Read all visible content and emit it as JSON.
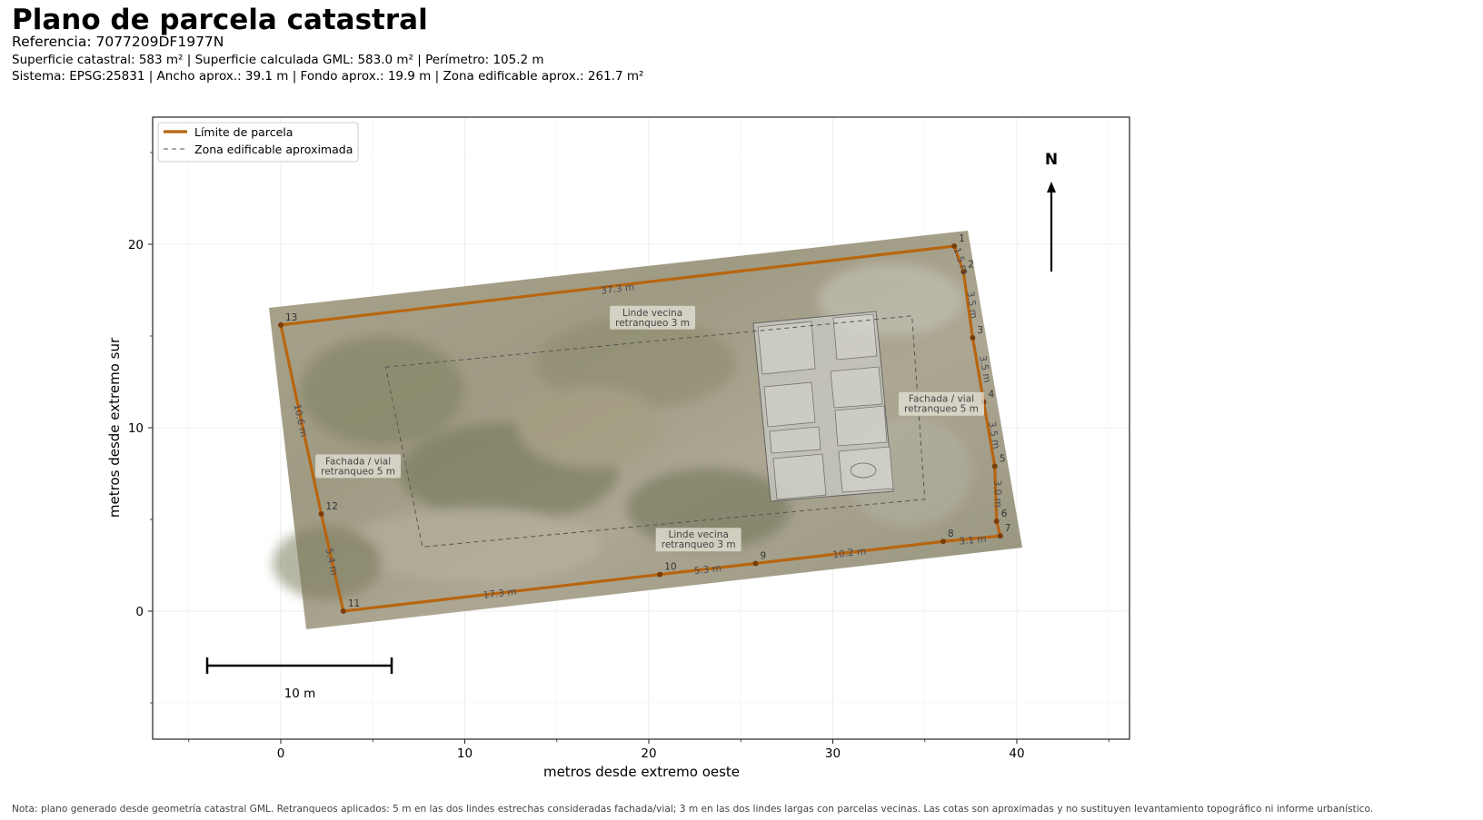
{
  "header": {
    "title": "Plano de parcela catastral",
    "reference": "Referencia: 7077209DF1977N",
    "line1": "Superficie catastral: 583 m² | Superficie calculada GML: 583.0 m² | Perímetro: 105.2 m",
    "line2": "Sistema: EPSG:25831 | Ancho aprox.: 39.1 m | Fondo aprox.: 19.9 m | Zona edificable aprox.: 261.7 m²"
  },
  "note": "Nota: plano generado desde geometría catastral GML. Retranqueos aplicados: 5 m en las dos lindes estrechas consideradas fachada/vial; 3 m en las dos lindes largas con parcelas vecinas. Las cotas son aproximadas y no sustituyen levantamiento topográfico ni informe urbanístico.",
  "legend": {
    "boundary": "Límite de parcela",
    "buildable": "Zona edificable aproximada"
  },
  "axes": {
    "xlabel": "metros desde extremo oeste",
    "ylabel": "metros desde extremo sur",
    "xticks": [
      0,
      10,
      20,
      30,
      40
    ],
    "yticks": [
      0,
      10,
      20
    ],
    "xlim": [
      -7,
      46
    ],
    "ylim": [
      -7,
      27
    ]
  },
  "colors": {
    "boundary": "#b8650f",
    "buildable": "#555555",
    "vertex": "#7a3d0a"
  },
  "north_label": "N",
  "scale_bar_label": "10 m",
  "parcel": {
    "vertices": [
      {
        "id": "1",
        "x": 36.6,
        "y": 19.9
      },
      {
        "id": "2",
        "x": 37.1,
        "y": 18.5
      },
      {
        "id": "3",
        "x": 37.6,
        "y": 14.9
      },
      {
        "id": "4",
        "x": 38.2,
        "y": 11.4
      },
      {
        "id": "5",
        "x": 38.8,
        "y": 7.9
      },
      {
        "id": "6",
        "x": 38.9,
        "y": 4.9
      },
      {
        "id": "7",
        "x": 39.1,
        "y": 4.1
      },
      {
        "id": "8",
        "x": 36.0,
        "y": 3.8
      },
      {
        "id": "9",
        "x": 25.8,
        "y": 2.6
      },
      {
        "id": "10",
        "x": 20.6,
        "y": 2.0
      },
      {
        "id": "11",
        "x": 3.4,
        "y": 0.0
      },
      {
        "id": "12",
        "x": 2.2,
        "y": 5.3
      },
      {
        "id": "13",
        "x": 0.0,
        "y": 15.6
      }
    ],
    "segment_labels": [
      {
        "text": "37.3 m",
        "x": 18.3,
        "y": 17.6
      },
      {
        "text": "1.5 m",
        "x": 37.0,
        "y": 19.1
      },
      {
        "text": "3.5 m",
        "x": 37.6,
        "y": 16.7
      },
      {
        "text": "3.5 m",
        "x": 38.3,
        "y": 13.2
      },
      {
        "text": "3.5 m",
        "x": 38.8,
        "y": 9.6
      },
      {
        "text": "3.0 m",
        "x": 39.0,
        "y": 6.4
      },
      {
        "text": "3.1 m",
        "x": 37.6,
        "y": 3.9
      },
      {
        "text": "10.2 m",
        "x": 30.9,
        "y": 3.2
      },
      {
        "text": "5.3 m",
        "x": 23.2,
        "y": 2.3
      },
      {
        "text": "17.3 m",
        "x": 11.9,
        "y": 1.0
      },
      {
        "text": "5.4 m",
        "x": 2.8,
        "y": 2.7
      },
      {
        "text": "10.6 m",
        "x": 1.1,
        "y": 10.4
      }
    ],
    "buildable_zone": [
      {
        "x": 5.7,
        "y": 13.3
      },
      {
        "x": 34.3,
        "y": 16.1
      },
      {
        "x": 35.0,
        "y": 6.1
      },
      {
        "x": 7.7,
        "y": 3.5
      }
    ],
    "annotations": [
      {
        "text": [
          "Linde vecina",
          "retranqueo 3 m"
        ],
        "x": 20.2,
        "y": 16.0
      },
      {
        "text": [
          "Linde vecina",
          "retranqueo 3 m"
        ],
        "x": 22.7,
        "y": 3.9
      },
      {
        "text": [
          "Fachada / vial",
          "retranqueo 5 m"
        ],
        "x": 35.9,
        "y": 11.3
      },
      {
        "text": [
          "Fachada / vial",
          "retranqueo 5 m"
        ],
        "x": 4.2,
        "y": 7.9
      }
    ]
  }
}
